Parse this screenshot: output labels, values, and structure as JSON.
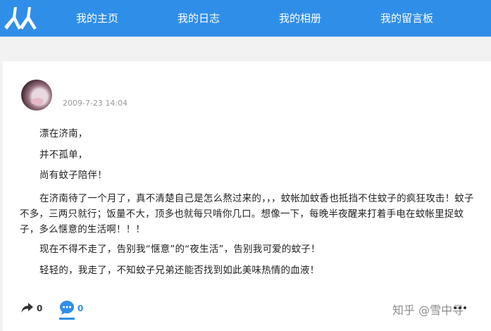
{
  "nav": {
    "items": [
      {
        "label": "我的主页"
      },
      {
        "label": "我的日志"
      },
      {
        "label": "我的相册"
      },
      {
        "label": "我的留言板"
      }
    ]
  },
  "post": {
    "timestamp": "2009-7-23 14:04",
    "paragraphs": [
      "漂在济南，",
      "并不孤单，",
      "尚有蚊子陪伴！",
      "在济南待了一个月了，真不清楚自己是怎么熬过来的，，，蚊帐加蚊香也抵挡不住蚊子的疯狂攻击！蚊子不多，三两只就行；饭量不大，顶多也就每只啃你几口。想像一下，每晚半夜醒来打着手电在蚊帐里捉蚊子，多么惬意的生活啊！！！",
      "现在不得不走了，告别我“惬意”的“夜生活”，告别我可爱的蚊子！",
      "轻轻的，我走了，不知蚊子兄弟还能否找到如此美味热情的血液！"
    ]
  },
  "footer": {
    "share_count": "0",
    "comment_count": "0",
    "watermark": "知乎 @雪中寻"
  },
  "colors": {
    "brand_blue": "#2f8ee8"
  },
  "icons": {
    "logo": "renren-logo-icon",
    "share": "share-arrow-icon",
    "comment": "comment-bubble-icon",
    "more": "more-icon"
  }
}
